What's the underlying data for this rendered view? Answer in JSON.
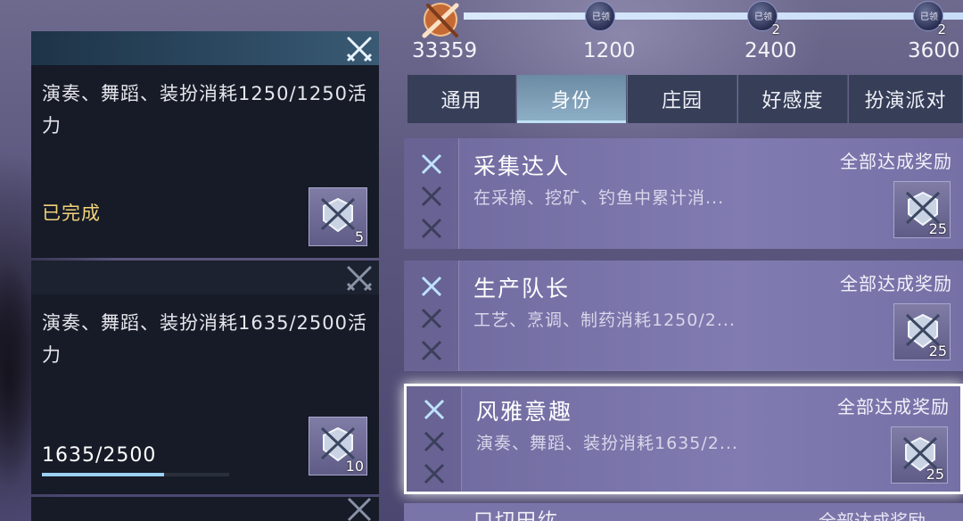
{
  "milestones": {
    "current_score": "33359",
    "track_fill": 1.0,
    "nodes": [
      {
        "threshold": "1200",
        "claimed_label": "已领",
        "count": ""
      },
      {
        "threshold": "2400",
        "claimed_label": "已领",
        "count": "2"
      },
      {
        "threshold": "3600",
        "claimed_label": "已领",
        "count": "2"
      }
    ]
  },
  "tabs": [
    {
      "label": "通用",
      "active": false
    },
    {
      "label": "身份",
      "active": true
    },
    {
      "label": "庄园",
      "active": false
    },
    {
      "label": "好感度",
      "active": false
    },
    {
      "label": "扮演派对",
      "active": false
    }
  ],
  "left_details": [
    {
      "description": "演奏、舞蹈、装扮消耗1250/1250活力",
      "status": "已完成",
      "reward_count": "5"
    },
    {
      "description": "演奏、舞蹈、装扮消耗1635/2500活力",
      "progress_text": "1635/2500",
      "progress_fraction": 0.654,
      "reward_count": "10"
    }
  ],
  "achievements": [
    {
      "title": "采集达人",
      "description": "在采摘、挖矿、钓鱼中累计消...",
      "reward_label": "全部达成奖励",
      "reward_count": "25"
    },
    {
      "title": "生产队长",
      "description": "工艺、烹调、制药消耗1250/2...",
      "reward_label": "全部达成奖励",
      "reward_count": "25"
    },
    {
      "title": "风雅意趣",
      "description": "演奏、舞蹈、装扮消耗1635/2...",
      "reward_label": "全部达成奖励",
      "reward_count": "25"
    }
  ],
  "partial_row": {
    "title": "口切田纮",
    "reward_label": "全部达成奖励"
  },
  "icons": {
    "tier": "crossed-swords-icon",
    "reward": "crossed-swords-shield-icon",
    "chest": "sword-medal-icon"
  },
  "colors": {
    "done_text": "#f2d27a",
    "progress_bar": "#9ad0f2",
    "active_tab": "#8fb1c8"
  }
}
